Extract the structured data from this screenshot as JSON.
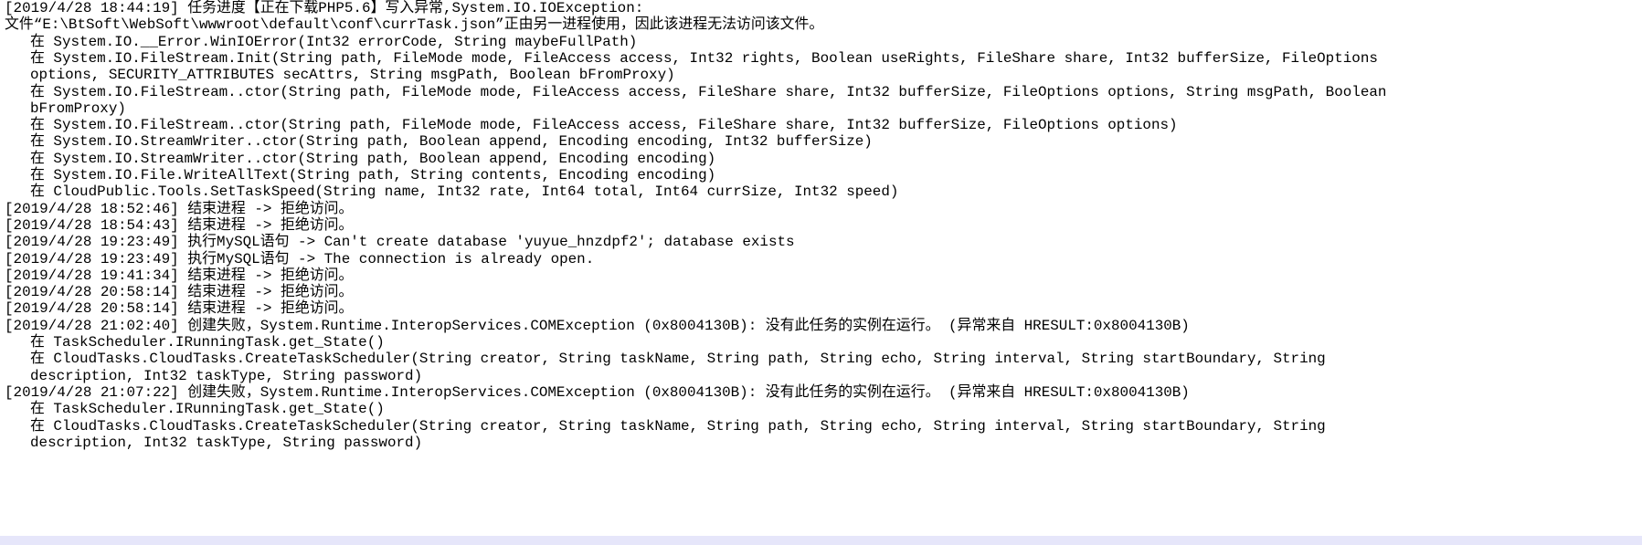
{
  "log_lines": [
    {
      "indent": false,
      "text": "[2019/4/28 18:44:19] 任务进度【正在下载PHP5.6】写入异常,System.IO.IOException:"
    },
    {
      "indent": false,
      "text": "文件“E:\\BtSoft\\WebSoft\\wwwroot\\default\\conf\\currTask.json”正由另一进程使用，因此该进程无法访问该文件。"
    },
    {
      "indent": true,
      "text": "在 System.IO.__Error.WinIOError(Int32 errorCode, String maybeFullPath)"
    },
    {
      "indent": true,
      "text": "在 System.IO.FileStream.Init(String path, FileMode mode, FileAccess access, Int32 rights, Boolean useRights, FileShare share, Int32 bufferSize, FileOptions"
    },
    {
      "indent": true,
      "text": "options, SECURITY_ATTRIBUTES secAttrs, String msgPath, Boolean bFromProxy)"
    },
    {
      "indent": true,
      "text": "在 System.IO.FileStream..ctor(String path, FileMode mode, FileAccess access, FileShare share, Int32 bufferSize, FileOptions options, String msgPath, Boolean"
    },
    {
      "indent": true,
      "text": "bFromProxy)"
    },
    {
      "indent": true,
      "text": "在 System.IO.FileStream..ctor(String path, FileMode mode, FileAccess access, FileShare share, Int32 bufferSize, FileOptions options)"
    },
    {
      "indent": true,
      "text": "在 System.IO.StreamWriter..ctor(String path, Boolean append, Encoding encoding, Int32 bufferSize)"
    },
    {
      "indent": true,
      "text": "在 System.IO.StreamWriter..ctor(String path, Boolean append, Encoding encoding)"
    },
    {
      "indent": true,
      "text": "在 System.IO.File.WriteAllText(String path, String contents, Encoding encoding)"
    },
    {
      "indent": true,
      "text": "在 CloudPublic.Tools.SetTaskSpeed(String name, Int32 rate, Int64 total, Int64 currSize, Int32 speed)"
    },
    {
      "indent": false,
      "text": "[2019/4/28 18:52:46] 结束进程 -> 拒绝访问。"
    },
    {
      "indent": false,
      "text": "[2019/4/28 18:54:43] 结束进程 -> 拒绝访问。"
    },
    {
      "indent": false,
      "text": "[2019/4/28 19:23:49] 执行MySQL语句 -> Can't create database 'yuyue_hnzdpf2'; database exists"
    },
    {
      "indent": false,
      "text": "[2019/4/28 19:23:49] 执行MySQL语句 -> The connection is already open."
    },
    {
      "indent": false,
      "text": "[2019/4/28 19:41:34] 结束进程 -> 拒绝访问。"
    },
    {
      "indent": false,
      "text": "[2019/4/28 20:58:14] 结束进程 -> 拒绝访问。"
    },
    {
      "indent": false,
      "text": "[2019/4/28 20:58:14] 结束进程 -> 拒绝访问。"
    },
    {
      "indent": false,
      "text": "[2019/4/28 21:02:40] 创建失败，System.Runtime.InteropServices.COMException (0x8004130B): 没有此任务的实例在运行。 (异常来自 HRESULT:0x8004130B)"
    },
    {
      "indent": true,
      "text": "在 TaskScheduler.IRunningTask.get_State()"
    },
    {
      "indent": true,
      "text": "在 CloudTasks.CloudTasks.CreateTaskScheduler(String creator, String taskName, String path, String echo, String interval, String startBoundary, String"
    },
    {
      "indent": true,
      "text": "description, Int32 taskType, String password)"
    },
    {
      "indent": false,
      "text": "[2019/4/28 21:07:22] 创建失败，System.Runtime.InteropServices.COMException (0x8004130B): 没有此任务的实例在运行。 (异常来自 HRESULT:0x8004130B)"
    },
    {
      "indent": true,
      "text": "在 TaskScheduler.IRunningTask.get_State()"
    },
    {
      "indent": true,
      "text": "在 CloudTasks.CloudTasks.CreateTaskScheduler(String creator, String taskName, String path, String echo, String interval, String startBoundary, String"
    },
    {
      "indent": true,
      "text": "description, Int32 taskType, String password)"
    }
  ]
}
